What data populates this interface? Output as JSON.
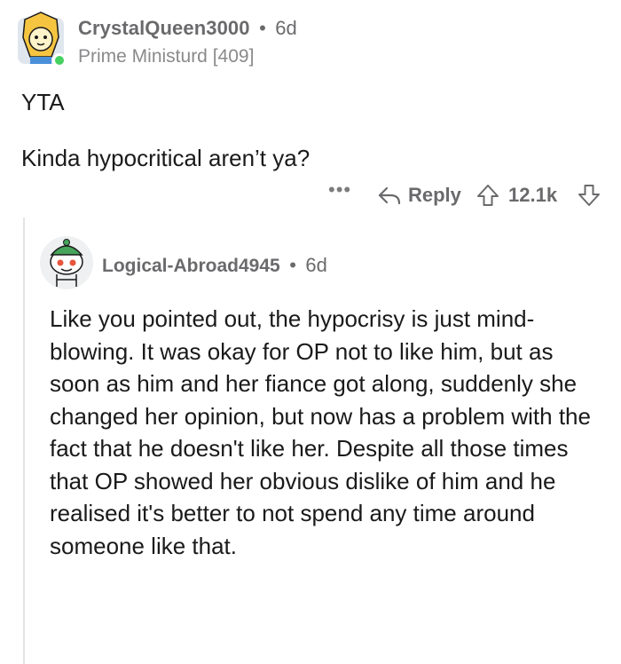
{
  "comment": {
    "username": "CrystalQueen3000",
    "separator": "•",
    "age": "6d",
    "flair": "Prime Ministurd [409]",
    "lines": [
      "YTA",
      "Kinda hypocritical aren’t ya?"
    ],
    "avatar_icon": "lion-avatar-icon",
    "online_color": "#46d160"
  },
  "actions": {
    "more": "•••",
    "reply_label": "Reply",
    "score": "12.1k"
  },
  "reply": {
    "username": "Logical-Abroad4945",
    "separator": "•",
    "age": "6d",
    "avatar_icon": "snoo-avatar-icon",
    "body": "Like you pointed out, the hypocrisy is just mind-blowing. It was okay for OP not to like him, but as soon as him and her fiance got along, suddenly she changed her opinion, but now has a problem with the fact that he doesn't like her. Despite all those times that OP showed her obvious dislike of him and he realised it's better to not spend any time around someone like that."
  }
}
